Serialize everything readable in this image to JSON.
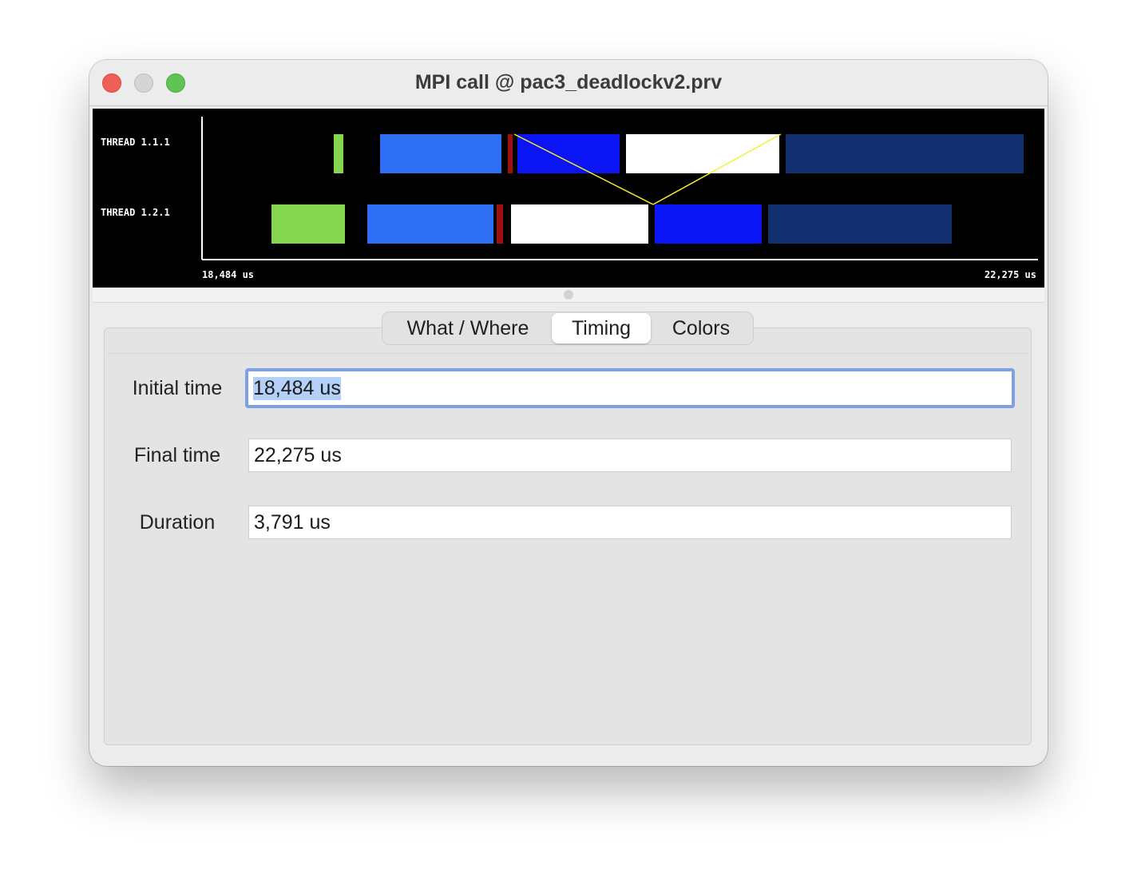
{
  "window": {
    "title": "MPI call @ pac3_deadlockv2.prv"
  },
  "timeline": {
    "threads": [
      {
        "label": "THREAD 1.1.1"
      },
      {
        "label": "THREAD 1.2.1"
      }
    ],
    "start_label": "18,484 us",
    "end_label": "22,275 us",
    "colors": {
      "green": "#84d64e",
      "light_blue": "#2f6ff3",
      "dark_red": "#a01010",
      "blue": "#0a14f5",
      "white": "#ffffff",
      "navy": "#12306f",
      "communication_line": "#f3ef2e"
    }
  },
  "tabs": [
    {
      "label": "What / Where"
    },
    {
      "label": "Timing"
    },
    {
      "label": "Colors"
    }
  ],
  "active_tab": "Timing",
  "timing": {
    "initial_label": "Initial time",
    "initial_value": "18,484 us",
    "final_label": "Final time",
    "final_value": "22,275 us",
    "duration_label": "Duration",
    "duration_value": "3,791 us"
  }
}
